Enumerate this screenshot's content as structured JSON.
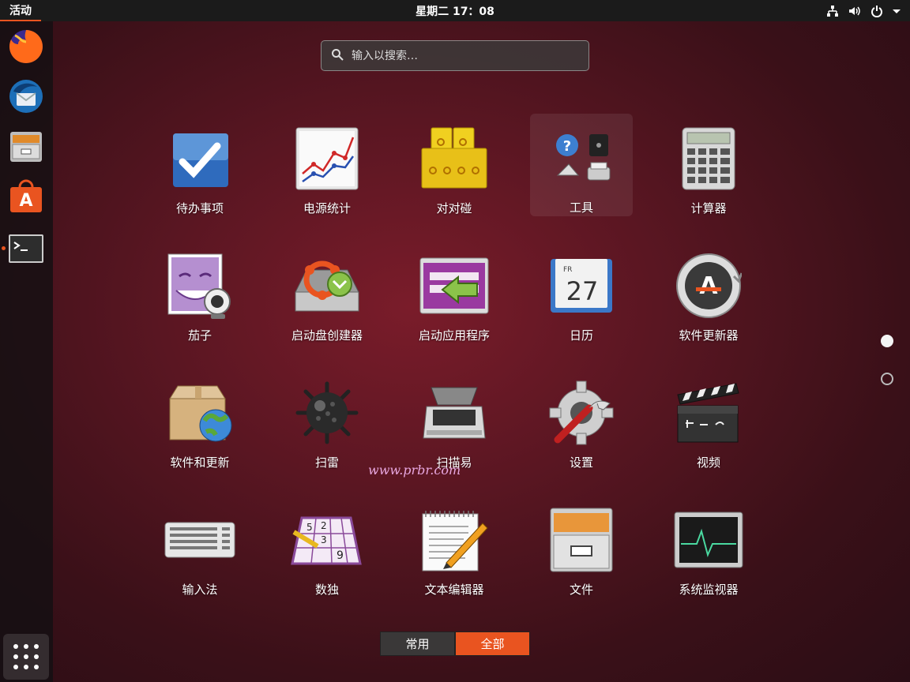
{
  "topbar": {
    "activities": "活动",
    "clock": "星期二 17：08",
    "icons": [
      "network-icon",
      "volume-icon",
      "power-icon",
      "chevron-down-icon"
    ]
  },
  "dock": {
    "items": [
      "firefox-icon",
      "thunderbird-icon",
      "files-icon",
      "software-icon",
      "terminal-icon"
    ],
    "running": "terminal-icon"
  },
  "search": {
    "placeholder": "输入以搜索…"
  },
  "apps": [
    {
      "label": "待办事项",
      "icon": "todo-icon"
    },
    {
      "label": "电源统计",
      "icon": "power-statistics-icon"
    },
    {
      "label": "对对碰",
      "icon": "swell-foop-icon"
    },
    {
      "label": "工具",
      "icon": "utilities-folder-icon"
    },
    {
      "label": "计算器",
      "icon": "calculator-icon"
    },
    {
      "label": "茄子",
      "icon": "cheese-icon"
    },
    {
      "label": "启动盘创建器",
      "icon": "startup-disk-creator-icon"
    },
    {
      "label": "启动应用程序",
      "icon": "startup-applications-icon"
    },
    {
      "label": "日历",
      "icon": "calendar-icon",
      "calendar_day": "FR",
      "calendar_date": "27"
    },
    {
      "label": "软件更新器",
      "icon": "software-updater-icon"
    },
    {
      "label": "软件和更新",
      "icon": "software-properties-icon"
    },
    {
      "label": "扫雷",
      "icon": "mines-icon"
    },
    {
      "label": "扫描易",
      "icon": "scanner-icon"
    },
    {
      "label": "设置",
      "icon": "settings-icon"
    },
    {
      "label": "视频",
      "icon": "videos-icon"
    },
    {
      "label": "输入法",
      "icon": "keyboard-icon"
    },
    {
      "label": "数独",
      "icon": "sudoku-icon"
    },
    {
      "label": "文本编辑器",
      "icon": "text-editor-icon"
    },
    {
      "label": "文件",
      "icon": "files-icon"
    },
    {
      "label": "系统监视器",
      "icon": "system-monitor-icon"
    }
  ],
  "sudoku_digits": [
    "5",
    "2",
    "3",
    "9"
  ],
  "pages": {
    "current": 1,
    "total": 2
  },
  "tabs": {
    "frequent": "常用",
    "all": "全部",
    "selected": "all"
  },
  "watermark": "www.prbr.com",
  "colors": {
    "accent": "#e95420",
    "topbar": "#1b1b1b"
  }
}
